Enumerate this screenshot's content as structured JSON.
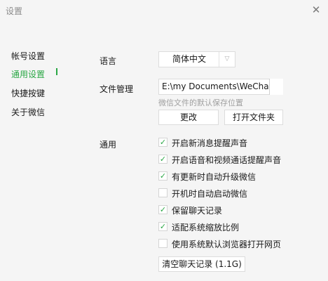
{
  "window": {
    "title": "设置",
    "close_glyph": "✕"
  },
  "sidebar": {
    "items": [
      {
        "label": "帐号设置"
      },
      {
        "label": "通用设置"
      },
      {
        "label": "快捷按键"
      },
      {
        "label": "关于微信"
      }
    ],
    "active_index": 1
  },
  "general": {
    "language": {
      "label": "语言",
      "value": "简体中文",
      "arrow_glyph": "▽"
    },
    "file_management": {
      "label": "文件管理",
      "path": "E:\\my Documents\\WeChat",
      "hint": "微信文件的默认保存位置",
      "change_button": "更改",
      "open_folder_button": "打开文件夹"
    },
    "general_section": {
      "label": "通用",
      "check_glyph": "✓",
      "options": [
        {
          "label": "开启新消息提醒声音",
          "checked": true
        },
        {
          "label": "开启语音和视频通话提醒声音",
          "checked": true
        },
        {
          "label": "有更新时自动升级微信",
          "checked": true
        },
        {
          "label": "开机时自动启动微信",
          "checked": false
        },
        {
          "label": "保留聊天记录",
          "checked": true
        },
        {
          "label": "适配系统缩放比例",
          "checked": true
        },
        {
          "label": "使用系统默认浏览器打开网页",
          "checked": false
        }
      ],
      "clear_history_button": "清空聊天记录 (1.1G)"
    }
  },
  "colors": {
    "accent": "#2aa745",
    "background": "#f5f5f5",
    "hint_text": "#a0a0a0"
  }
}
